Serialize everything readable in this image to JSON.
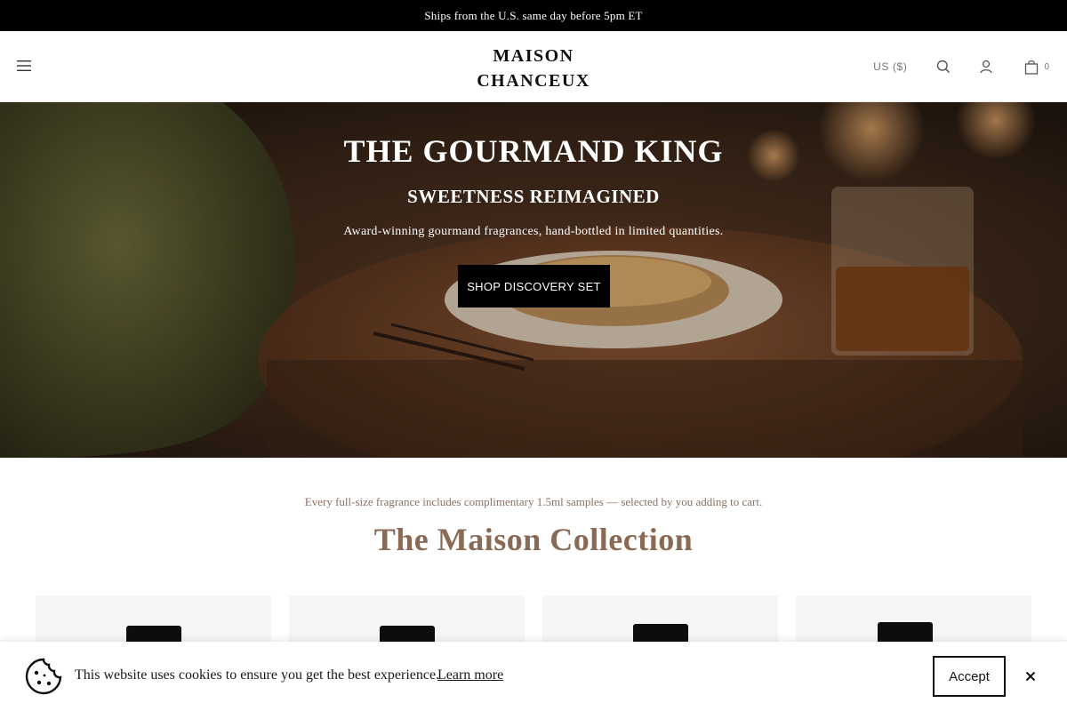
{
  "announcement": {
    "text": "Ships from the U.S. same day before 5pm ET"
  },
  "header": {
    "logo_line1": "MAISON",
    "logo_line2": "CHANCEUX",
    "currency": "US ($)",
    "cart_count": "0",
    "icons": [
      "hamburger-icon",
      "search-icon",
      "account-icon",
      "bag-icon"
    ]
  },
  "hero": {
    "title": "THE GOURMAND KING",
    "subtitle": "SWEETNESS REIMAGINED",
    "description": "Award-winning gourmand fragrances, hand-bottled in limited quantities.",
    "cta_label": "SHOP DISCOVERY SET"
  },
  "collection": {
    "notice": "Every full-size fragrance includes complimentary 1.5ml samples — selected by you adding to cart.",
    "title": "The Maison Collection",
    "product_count": 4
  },
  "cookie": {
    "text": "This website uses cookies to ensure you get the best experience.",
    "link_label": "Learn more",
    "accept_label": "Accept"
  },
  "colors": {
    "announcement_bg": "#000000",
    "accent_brown": "#8a6a55",
    "cta_bg": "#000000"
  }
}
